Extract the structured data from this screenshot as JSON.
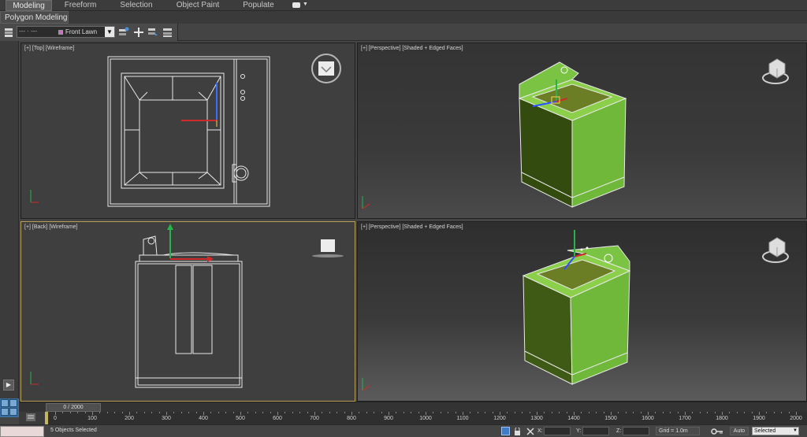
{
  "ribbon": {
    "tabs": [
      {
        "label": "Modeling",
        "active": true
      },
      {
        "label": "Freeform",
        "active": false
      },
      {
        "label": "Selection",
        "active": false
      },
      {
        "label": "Object Paint",
        "active": false
      },
      {
        "label": "Populate",
        "active": false
      }
    ],
    "sub_tab": "Polygon Modeling"
  },
  "toolbar": {
    "layer_dots": "--- · ---",
    "layer_name": "Front Lawn"
  },
  "viewports": {
    "top": {
      "label": "[+] [Top] [Wireframe]"
    },
    "back": {
      "label": "[+] [Back] [Wireframe]"
    },
    "persp1": {
      "label": "[+] [Perspective] [Shaded + Edged Faces]"
    },
    "persp2": {
      "label": "[+] [Perspective] [Shaded + Edged Faces]"
    }
  },
  "timeline": {
    "slider": "0 / 2000",
    "ticks": [
      "0",
      "100",
      "200",
      "300",
      "400",
      "500",
      "600",
      "700",
      "800",
      "900",
      "1000",
      "1100",
      "1200",
      "1300",
      "1400",
      "1500",
      "1600",
      "1700",
      "1800",
      "1900",
      "2000"
    ]
  },
  "status": {
    "selection_text": "5 Objects Selected",
    "x_label": "X:",
    "y_label": "Y:",
    "z_label": "Z:",
    "grid": "Grid = 1.0m",
    "auto": "Auto",
    "key_filter": "Selected"
  },
  "colors": {
    "model_green": "#6fb83a",
    "model_dark": "#3e5a14",
    "selection_yellow": "#b89d57",
    "ui_dark": "#444444"
  }
}
